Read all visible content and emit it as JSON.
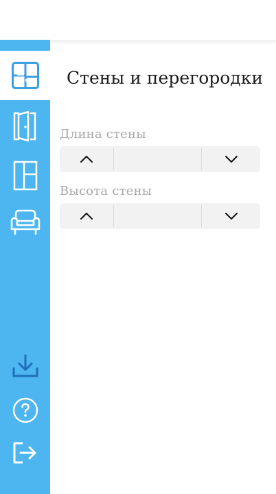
{
  "panel": {
    "title": "Стены и перегородки",
    "fields": [
      {
        "label": "Длина стены",
        "value": ""
      },
      {
        "label": "Высота стены",
        "value": ""
      }
    ]
  },
  "sidebar": {
    "items": [
      {
        "icon": "walls-icon",
        "active": true
      },
      {
        "icon": "door-icon",
        "active": false
      },
      {
        "icon": "window-icon",
        "active": false
      },
      {
        "icon": "armchair-icon",
        "active": false
      },
      {
        "icon": "download-icon",
        "active": false
      },
      {
        "icon": "help-icon",
        "active": false
      },
      {
        "icon": "logout-icon",
        "active": false
      }
    ]
  },
  "colors": {
    "sidebar": "#4db5ef",
    "active_icon": "#3a9fe0",
    "icon": "#ffffff",
    "download_icon": "#1e6fb8",
    "label": "#a9a9a9",
    "stepper_bg": "#f2f2f2"
  }
}
